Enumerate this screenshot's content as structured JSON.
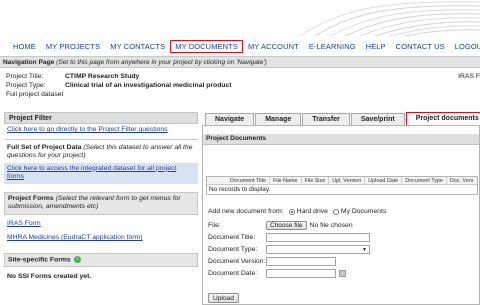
{
  "topnav": {
    "items": [
      {
        "label": "HOME"
      },
      {
        "label": "MY PROJECTS"
      },
      {
        "label": "MY CONTACTS"
      },
      {
        "label": "MY DOCUMENTS"
      },
      {
        "label": "MY ACCOUNT"
      },
      {
        "label": "E-LEARNING"
      },
      {
        "label": "HELP"
      },
      {
        "label": "CONTACT US"
      },
      {
        "label": "LOGOUT"
      }
    ],
    "active_index": 3,
    "active_outline_color": "#d0141b"
  },
  "navpage": {
    "label": "Navigation Page",
    "hint": "(Set to this page from anywhere in your project by clicking on 'Navigate')"
  },
  "project": {
    "title_label": "Project Title:",
    "title_value": "CTIMP Research Study",
    "type_label": "Project Type:",
    "type_value": "Clinical trial of an investigational medicinal product",
    "dataset_label": "Full project dataset",
    "iras_label": "IRAS F"
  },
  "sidebar": {
    "filter_head": "Project Filter",
    "filter_link": "Click here to go directly to the Project Filter questions",
    "fullset_title": "Full Set of Project Data",
    "fullset_hint": "(Select this dataset to answer all the questions for your project)",
    "integrated_link": "Click here to access the integrated dataset for all project forms",
    "forms_title": "Project Forms",
    "forms_hint": "(Select the relevant form to get menus for submission, amendments etc)",
    "form_links": [
      "IRAS Form",
      "MHRA Medicines (EudraCT application form)"
    ],
    "site_head": "Site-specific Forms",
    "site_text": "No SSI Forms created yet."
  },
  "main": {
    "tabs": [
      "Navigate",
      "Manage",
      "Transfer",
      "Save/print",
      "Project documents"
    ],
    "active_tab_index": 4,
    "panel_title": "Project Documents",
    "table": {
      "columns": [
        "Document Title",
        "File Name",
        "File Size",
        "Upl. Version",
        "Upload Date",
        "Document Type",
        "Doc. Vers"
      ],
      "empty_text": "No records to display."
    },
    "form": {
      "add_from_label": "Add new document from:",
      "source_options": [
        "Hard drive",
        "My Documents"
      ],
      "selected_source": "Hard drive",
      "file_label": "File:",
      "choose_file": "Choose file",
      "no_file": "No file chosen",
      "title_label": "Document Title:",
      "type_label": "Document Type:",
      "version_label": "Document Version:",
      "date_label": "Document Date:",
      "upload_button": "Upload"
    }
  }
}
